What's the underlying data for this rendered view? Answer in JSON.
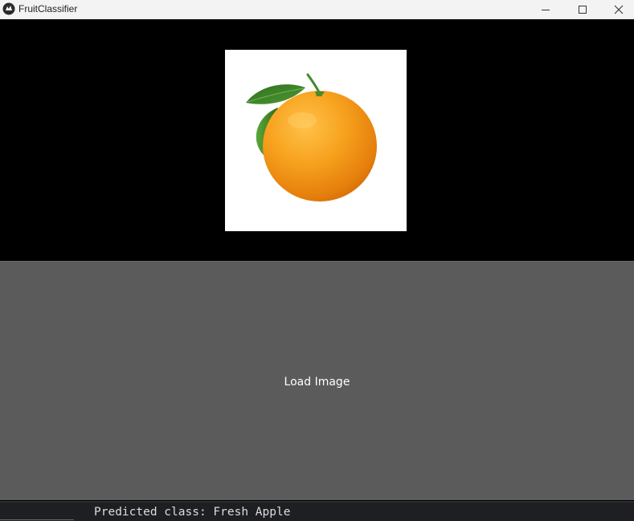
{
  "window": {
    "title": "FruitClassifier",
    "app_icon": "kivy-logo-icon",
    "controls": {
      "minimize_icon": "minimize-icon",
      "maximize_icon": "maximize-icon",
      "close_icon": "close-icon"
    }
  },
  "preview": {
    "image_subject": "orange-with-leaves",
    "image_background": "#ffffff",
    "fruit_color": "#f39a1a",
    "leaf_color": "#3f8a2a"
  },
  "actions": {
    "load_image_label": "Load Image"
  },
  "console": {
    "output_line": "Predicted class: Fresh Apple"
  },
  "colors": {
    "background": "#000000",
    "button_bg": "#5b5b5b",
    "button_text": "#ffffff",
    "titlebar_bg": "#f3f3f3",
    "console_bg": "#1e1f22",
    "console_text": "#dcdcdc"
  }
}
